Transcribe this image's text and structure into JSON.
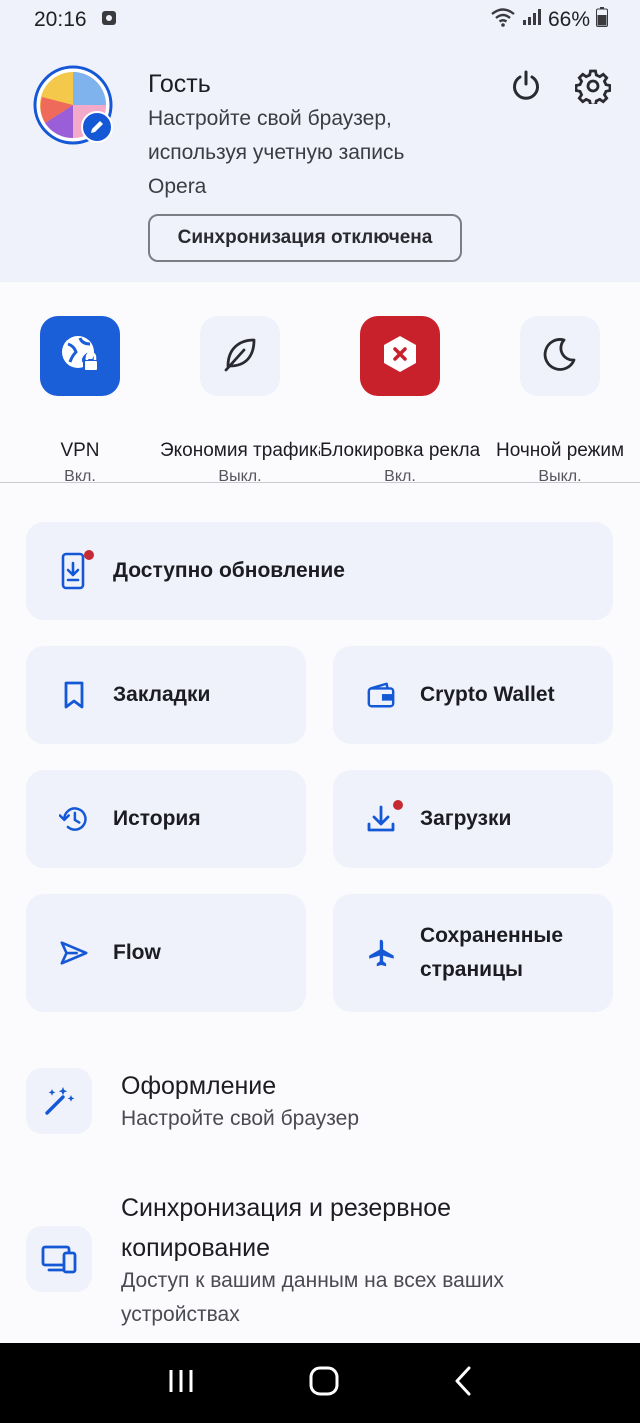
{
  "status_bar": {
    "time": "20:16",
    "battery": "66%"
  },
  "profile": {
    "name": "Гость",
    "description": "Настройте свой браузер, используя учетную запись Opera",
    "sync_button": "Синхронизация отключена"
  },
  "quick_settings": [
    {
      "label": "VPN",
      "state": "Вкл."
    },
    {
      "label": "Экономия трафика",
      "state": "Выкл."
    },
    {
      "label": "Блокировка рекламы",
      "state": "Вкл."
    },
    {
      "label": "Ночной режим",
      "state": "Выкл."
    }
  ],
  "cards": {
    "update": "Доступно обновление",
    "bookmarks": "Закладки",
    "wallet": "Crypto Wallet",
    "history": "История",
    "downloads": "Загрузки",
    "flow": "Flow",
    "saved_pages": "Сохраненные страницы"
  },
  "list": {
    "appearance_title": "Оформление",
    "appearance_sub": "Настройте свой браузер",
    "sync_title": "Синхронизация и резервное копирование",
    "sync_sub": "Доступ к вашим данным на всех ваших устройствах"
  },
  "colors": {
    "accent": "#1558d6",
    "vpn_tile": "#1a5fd7",
    "adblock_tile": "#c8212b",
    "badge": "#c62a35"
  }
}
